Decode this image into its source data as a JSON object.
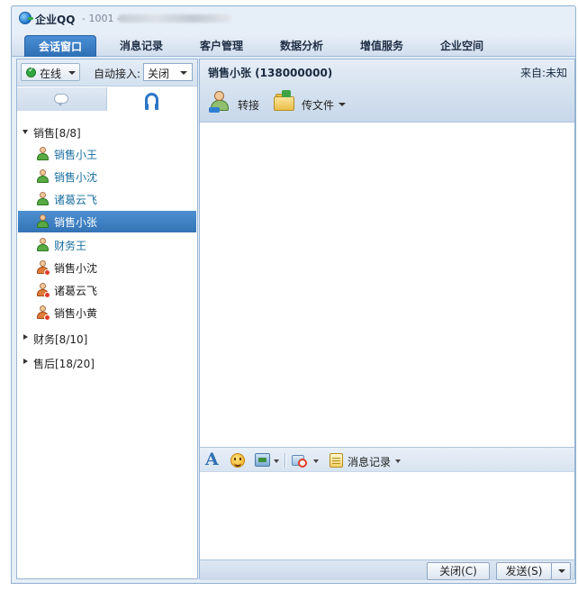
{
  "window": {
    "app_title": "企业QQ",
    "app_subtitle": "- 1001 -"
  },
  "tabs": [
    {
      "label": "会话窗口",
      "active": true
    },
    {
      "label": "消息记录",
      "active": false
    },
    {
      "label": "客户管理",
      "active": false
    },
    {
      "label": "数据分析",
      "active": false
    },
    {
      "label": "增值服务",
      "active": false
    },
    {
      "label": "企业空间",
      "active": false
    }
  ],
  "sidebar": {
    "status": "在线",
    "auto_accept_label": "自动接入:",
    "auto_accept_value": "关闭",
    "groups": [
      {
        "label": "销售[8/8]",
        "expanded": true
      },
      {
        "label": "财务[8/10]",
        "expanded": false
      },
      {
        "label": "售后[18/20]",
        "expanded": false
      }
    ],
    "contacts": [
      {
        "name": "销售小王",
        "state": "online",
        "selected": false
      },
      {
        "name": "销售小沈",
        "state": "online",
        "selected": false
      },
      {
        "name": "诸葛云飞",
        "state": "online",
        "selected": false
      },
      {
        "name": "销售小张",
        "state": "online",
        "selected": true
      },
      {
        "name": "财务王",
        "state": "online",
        "selected": false
      },
      {
        "name": "销售小沈",
        "state": "busy",
        "selected": false
      },
      {
        "name": "诸葛云飞",
        "state": "busy",
        "selected": false
      },
      {
        "name": "销售小黄",
        "state": "busy",
        "selected": false
      }
    ]
  },
  "chat": {
    "title": "销售小张 (138000000)",
    "source": "来自:未知",
    "transfer_label": "转接",
    "send_file_label": "传文件",
    "history_label": "消息记录",
    "close_label": "关闭(C)",
    "send_label": "发送(S)"
  },
  "colors": {
    "accent": "#2f6fb4",
    "selected_row": "#3f80c4",
    "online_name": "#1a6fa0"
  }
}
